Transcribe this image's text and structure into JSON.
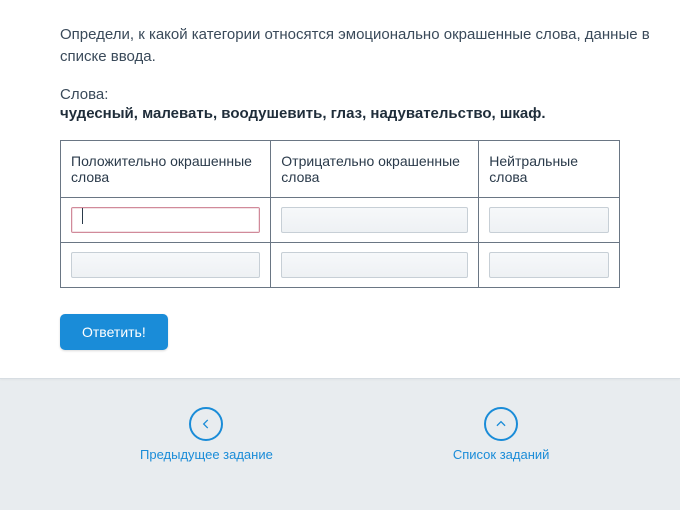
{
  "task": {
    "instruction": "Определи, к какой категории относятся эмоционально окрашенные слова, данные в списке ввода.",
    "words_label": "Слова:",
    "words_list": "чудесный, малевать, воодушевить, глаз, надувательство, шкаф."
  },
  "table": {
    "headers": {
      "positive": "Положительно окрашенные слова",
      "negative": "Отрицательно окрашенные слова",
      "neutral": "Нейтральные слова"
    },
    "cells": {
      "pos1": "",
      "pos2": "",
      "neg1": "",
      "neg2": "",
      "neu1": "",
      "neu2": ""
    }
  },
  "buttons": {
    "submit": "Ответить!"
  },
  "nav": {
    "prev": "Предыдущее задание",
    "list": "Список заданий"
  }
}
